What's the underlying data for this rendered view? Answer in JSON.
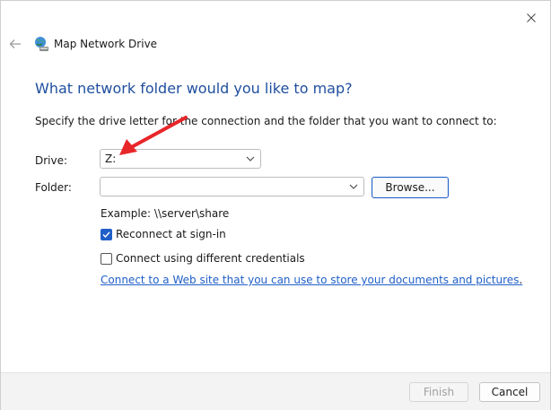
{
  "window": {
    "title": "Map Network Drive",
    "icons": {
      "close": "close-icon",
      "back": "back-arrow-icon",
      "title": "network-drive-icon"
    }
  },
  "main": {
    "heading": "What network folder would you like to map?",
    "description": "Specify the drive letter for the connection and the folder that you want to connect to:",
    "drive_label": "Drive:",
    "drive_value": "Z:",
    "folder_label": "Folder:",
    "folder_value": "",
    "browse_label": "Browse...",
    "example": "Example: \\\\server\\share",
    "reconnect_label": "Reconnect at sign-in",
    "reconnect_checked": true,
    "credentials_label": "Connect using different credentials",
    "credentials_checked": false,
    "link_text": "Connect to a Web site that you can use to store your documents and pictures",
    "link_suffix": "."
  },
  "footer": {
    "finish_label": "Finish",
    "cancel_label": "Cancel"
  },
  "colors": {
    "heading": "#1f4e9e",
    "accent": "#1f5fc7",
    "annotation_arrow": "#e8262a"
  }
}
